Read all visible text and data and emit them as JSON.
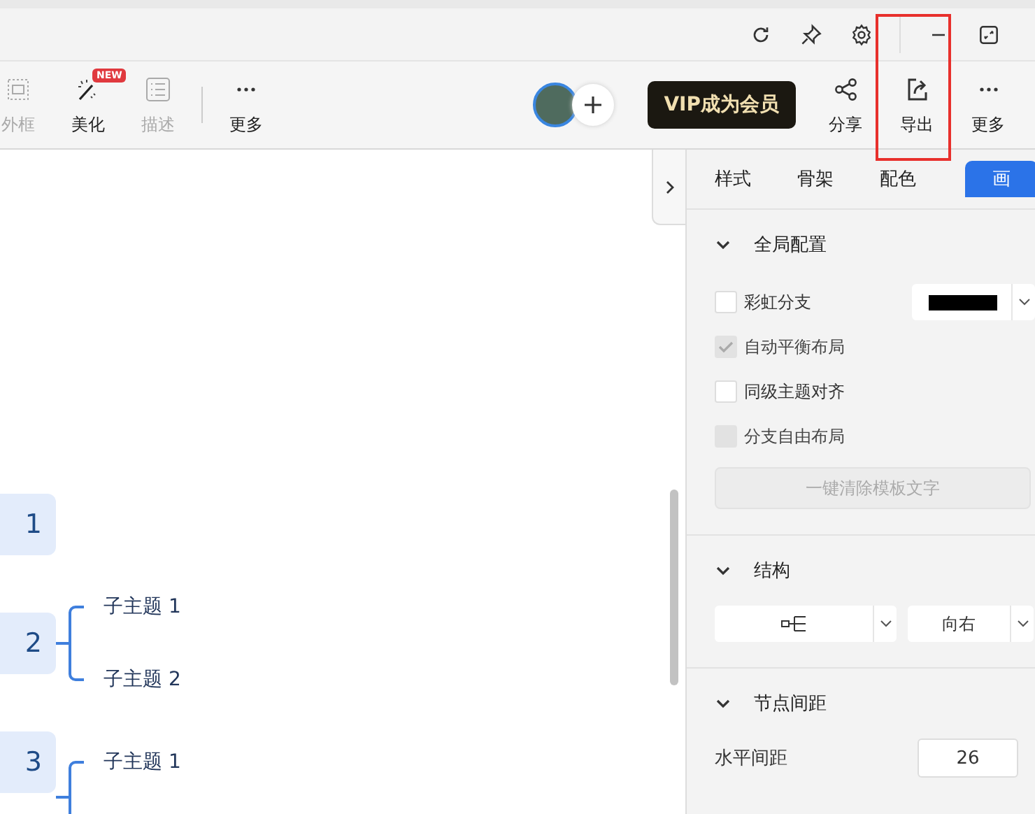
{
  "toolbar": {
    "left_items": [
      {
        "label": "外框",
        "kind": "frame",
        "disabled": true
      },
      {
        "label": "美化",
        "kind": "magic",
        "disabled": false,
        "badge": "NEW"
      },
      {
        "label": "描述",
        "kind": "list",
        "disabled": true
      },
      {
        "label": "更多",
        "kind": "more",
        "disabled": false
      }
    ],
    "vip_button": "VIP成为会员",
    "right_items": [
      {
        "label": "分享",
        "kind": "share"
      },
      {
        "label": "导出",
        "kind": "export",
        "highlighted": true
      },
      {
        "label": "更多",
        "kind": "more"
      }
    ]
  },
  "canvas": {
    "topics": [
      {
        "label": "1"
      },
      {
        "label": "2",
        "children": [
          {
            "label": "子主题 1"
          },
          {
            "label": "子主题 2"
          }
        ]
      },
      {
        "label": "3",
        "children": [
          {
            "label": "子主题 1"
          }
        ]
      }
    ]
  },
  "panel": {
    "tabs": [
      {
        "label": "样式",
        "selected": false
      },
      {
        "label": "骨架",
        "selected": false
      },
      {
        "label": "配色",
        "selected": false
      },
      {
        "label": "画",
        "selected": true
      }
    ],
    "global_section": {
      "title": "全局配置",
      "expanded": true,
      "color": "#000000",
      "options": [
        {
          "label": "彩虹分支",
          "checked": false,
          "disabled": false
        },
        {
          "label": "自动平衡布局",
          "checked": true,
          "disabled": true
        },
        {
          "label": "同级主题对齐",
          "checked": false,
          "disabled": false
        },
        {
          "label": "分支自由布局",
          "checked": false,
          "disabled": true
        }
      ],
      "clear_button": {
        "label": "一键清除模板文字",
        "disabled": true
      }
    },
    "structure_section": {
      "title": "结构",
      "expanded": true,
      "direction": "向右"
    },
    "spacing_section": {
      "title": "节点间距",
      "expanded": true,
      "field_label": "水平间距",
      "value": "26"
    }
  }
}
